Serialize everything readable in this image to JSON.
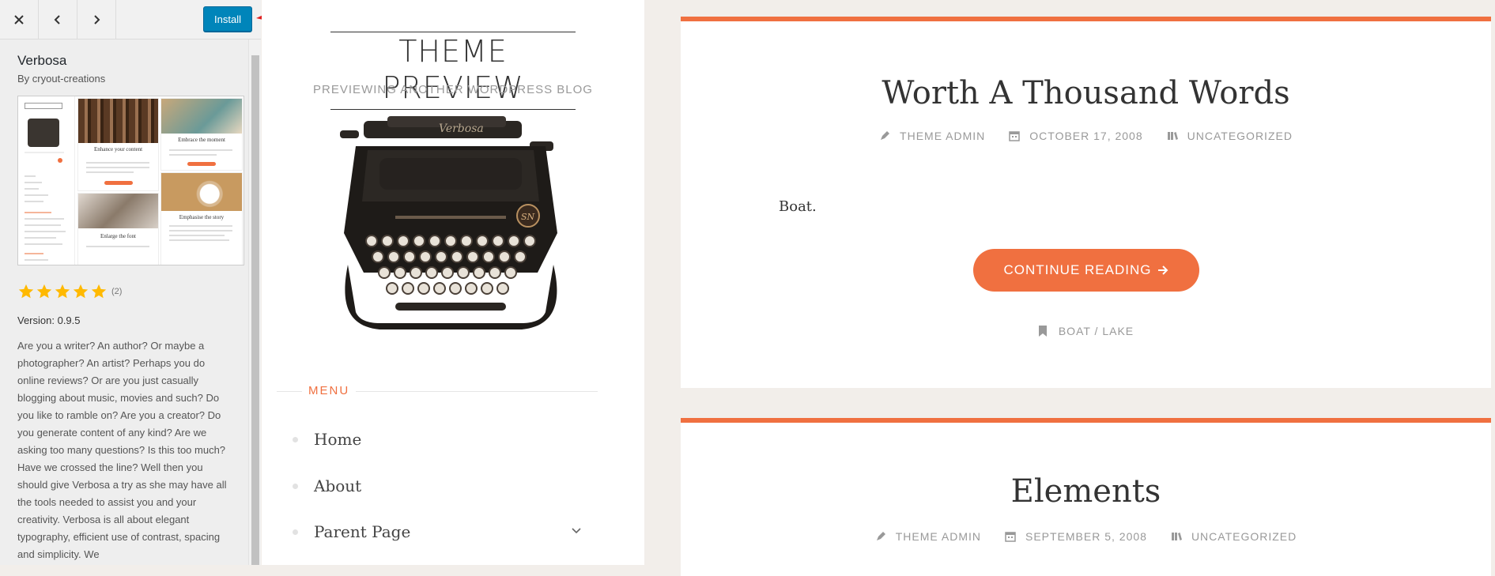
{
  "topbar": {
    "install_label": "Install"
  },
  "theme": {
    "name": "Verbosa",
    "author": "By cryout-creations",
    "rating_count": "(2)",
    "rating": 5,
    "version": "Version: 0.9.5",
    "description": "Are you a writer? An author? Or maybe a photographer? An artist? Perhaps you do online reviews? Or are you just casually blogging about music, movies and such? Do you like to ramble on? Are you a creator? Do you generate content of any kind? Are we asking too many questions? Is this too much? Have we crossed the line? Well then you should give Verbosa a try as she may have all the tools needed to assist you and your creativity. Verbosa is all about elegant typography, efficient use of contrast, spacing and simplicity. We"
  },
  "screenshot_thumb": {
    "tiles": [
      "Enhance your content",
      "Embrace the moment",
      "Enlarge the font",
      "Emphasise the story"
    ]
  },
  "site": {
    "title": "THEME PREVIEW",
    "description": "PREVIEWING ANOTHER WORDPRESS BLOG",
    "menu_label": "MENU",
    "menu_items": [
      "Home",
      "About",
      "Parent Page"
    ]
  },
  "posts": [
    {
      "title": "Worth A Thousand Words",
      "author": "THEME ADMIN",
      "date": "OCTOBER 17, 2008",
      "category": "UNCATEGORIZED",
      "excerpt": "Boat.",
      "continue_label": "CONTINUE READING",
      "tags": "BOAT / LAKE"
    },
    {
      "title": "Elements",
      "author": "THEME ADMIN",
      "date": "SEPTEMBER 5, 2008",
      "category": "UNCATEGORIZED"
    }
  ],
  "colors": {
    "accent": "#f07040",
    "install_blue": "#0085ba",
    "annotation_arrow": "#e02020"
  }
}
